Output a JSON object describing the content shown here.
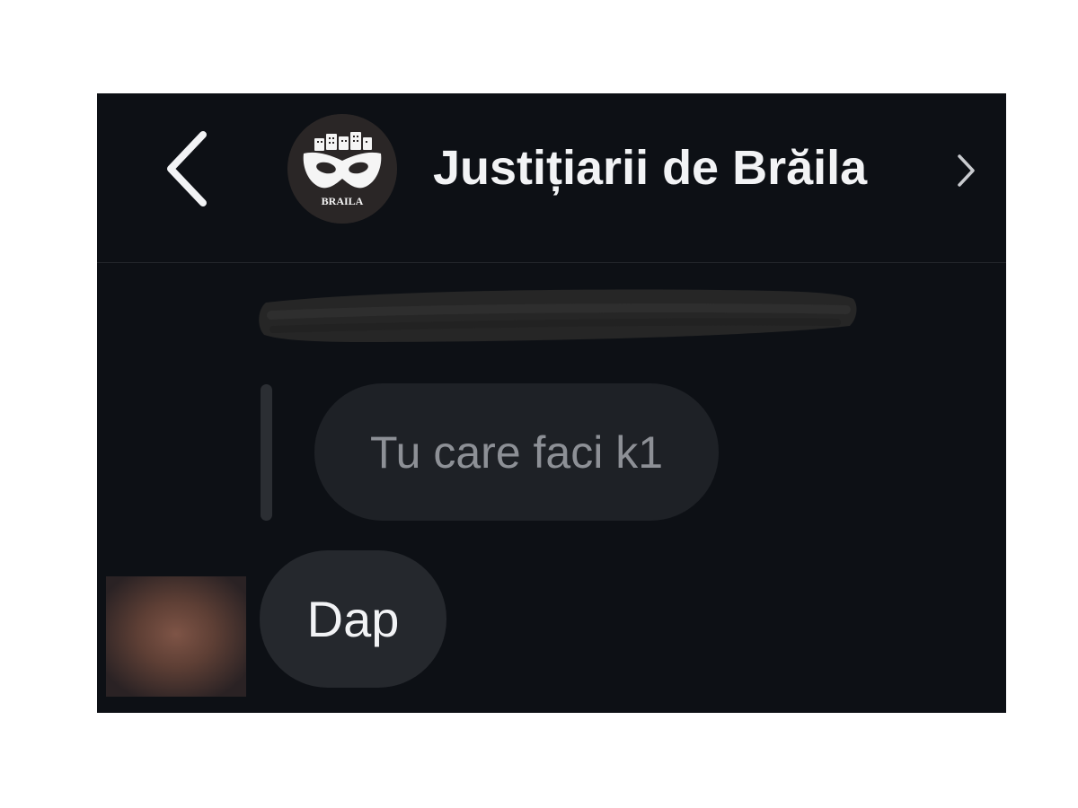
{
  "header": {
    "group_name": "Justițiarii de Brăila",
    "back_icon": "chevron-left-icon",
    "details_icon": "chevron-right-icon",
    "avatar": {
      "logo_text": "BRAILA",
      "icon": "mask-logo-icon"
    }
  },
  "messages": [
    {
      "type": "redacted",
      "note_icon": "redaction-scribble"
    },
    {
      "type": "quoted-reply",
      "text": "Tu care faci k1"
    },
    {
      "type": "received",
      "text": "Dap",
      "sender_avatar": "blurred-avatar"
    }
  ],
  "colors": {
    "background": "#0d1015",
    "bubble_received": "#25282d",
    "bubble_quoted": "#1e2126",
    "text_primary": "#f2f3f5",
    "text_quoted": "#8d9096"
  }
}
